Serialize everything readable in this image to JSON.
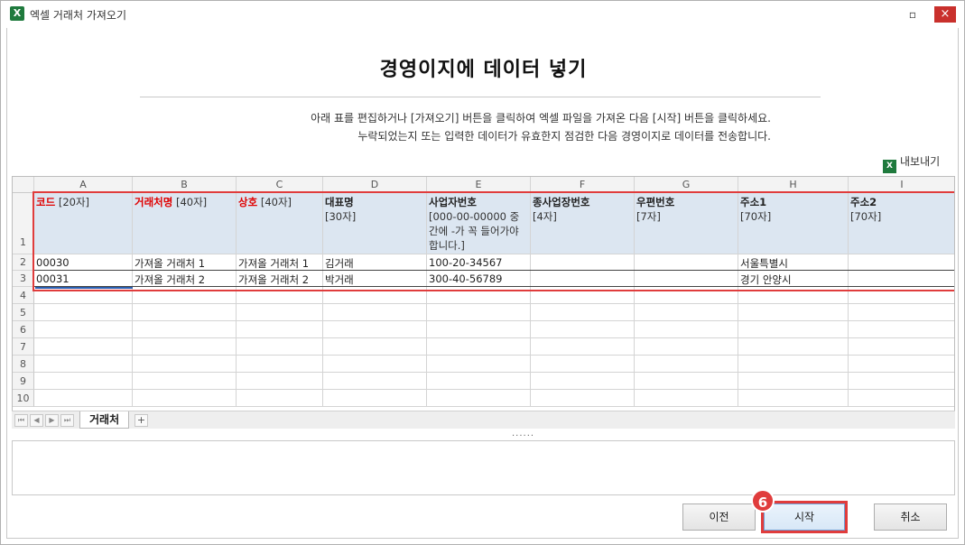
{
  "window": {
    "title": "엑셀 거래처 가져오기",
    "icon": "excel-icon",
    "minimize": "▫",
    "close": "×"
  },
  "page": {
    "heading": "경영이지에 데이터 넣기",
    "desc1": "아래 표를 편집하거나 [가져오기] 버튼을 클릭하여 엑셀 파일을 가져온 다음 [시작] 버튼을 클릭하세요.",
    "desc2": "누락되었는지 또는 입력한 데이터가 유효한지 점검한 다음 경영이지로 데이터를 전송합니다.",
    "export_label": "내보내기"
  },
  "sheet": {
    "columns": [
      "A",
      "B",
      "C",
      "D",
      "E",
      "F",
      "G",
      "H",
      "I"
    ],
    "row_numbers": [
      "1",
      "2",
      "3",
      "4",
      "5",
      "6",
      "7",
      "8",
      "9",
      "10"
    ],
    "header_row": [
      {
        "name": "코드",
        "note": "[20자]",
        "required": true
      },
      {
        "name": "거래처명",
        "note": "[40자]",
        "required": true
      },
      {
        "name": "상호",
        "note": "[40자]",
        "required": true
      },
      {
        "name": "대표명",
        "note": "[30자]",
        "required": false
      },
      {
        "name": "사업자번호",
        "note": "[000-00-00000 중간에 -가 꼭 들어가야 합니다.]",
        "required": false
      },
      {
        "name": "종사업장번호",
        "note": "[4자]",
        "required": false
      },
      {
        "name": "우편번호",
        "note": "[7자]",
        "required": false
      },
      {
        "name": "주소1",
        "note": "[70자]",
        "required": false
      },
      {
        "name": "주소2",
        "note": "[70자]",
        "required": false
      }
    ],
    "rows": [
      [
        "00030",
        "가져올 거래처 1",
        "가져올 거래처 1",
        "김거래",
        "100-20-34567",
        "",
        "",
        "서울특별시",
        ""
      ],
      [
        "00031",
        "가져올 거래처 2",
        "가져올 거래처 2",
        "박거래",
        "300-40-56789",
        "",
        "",
        "경기 안양시",
        ""
      ]
    ],
    "tab_name": "거래처",
    "add_tab": "+",
    "nav": [
      "⏮",
      "◀",
      "▶",
      "⏭"
    ]
  },
  "footer": {
    "grip": "......",
    "prev_button": "이전",
    "start_button": "시작",
    "cancel_button": "취소",
    "step_badge": "6",
    "highlight_color": "#e03c3c"
  }
}
